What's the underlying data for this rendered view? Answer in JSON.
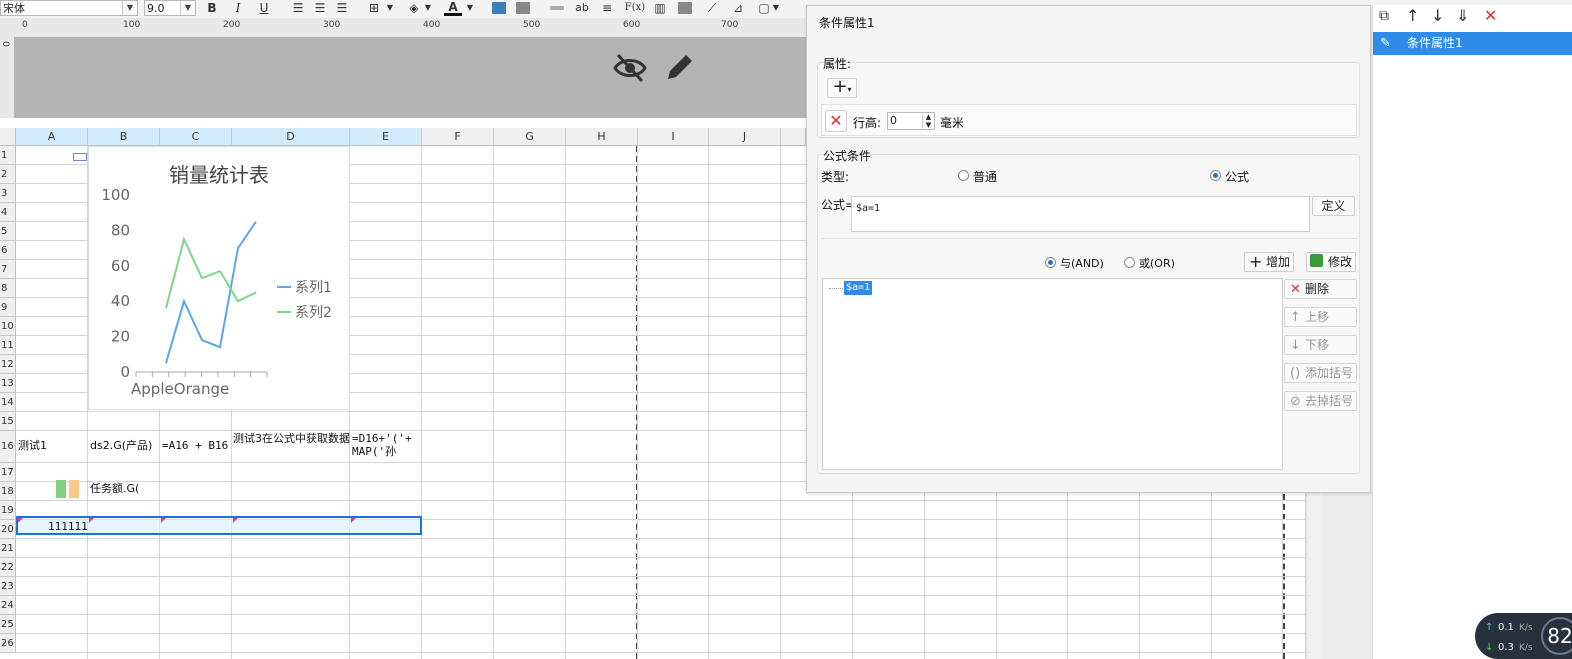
{
  "toolbar": {
    "font_name": "宋体",
    "font_size": "9.0",
    "bold": "B",
    "italic": "I",
    "underline": "U",
    "font_color_letter": "A",
    "text_icon": "ab",
    "formula_icon": "F(x)"
  },
  "ruler": {
    "ticks": [
      "0",
      "100",
      "200",
      "300",
      "400",
      "500",
      "600",
      "700"
    ]
  },
  "band_icons": [
    "eye-off-icon",
    "pencil-icon"
  ],
  "grid": {
    "columns": [
      "A",
      "B",
      "C",
      "D",
      "E",
      "F",
      "G",
      "H",
      "I",
      "J"
    ],
    "rows": [
      "1",
      "2",
      "3",
      "4",
      "5",
      "6",
      "7",
      "8",
      "9",
      "10",
      "11",
      "12",
      "13",
      "14",
      "15",
      "16",
      "17",
      "18",
      "19",
      "20",
      "21",
      "22",
      "23",
      "24",
      "25",
      "26"
    ],
    "cells": {
      "a16": "测试1",
      "b16": "ds2.G(产品)",
      "c16": "=A16 + B16",
      "d16": "测试3在公式中获取数据",
      "e16": "=D16+'('+ MAP('孙",
      "b18": "任务额.G(",
      "a20": "111111"
    }
  },
  "chart_data": {
    "type": "line",
    "title": "销量统计表",
    "x": [
      "Apple",
      "",
      "Orange",
      "",
      "",
      "",
      "",
      ""
    ],
    "tick_labels_x": [
      "Apple",
      "Orange"
    ],
    "ylim": [
      0,
      100
    ],
    "yticks": [
      "0",
      "20",
      "40",
      "60",
      "80",
      "100"
    ],
    "series": [
      {
        "name": "系列1",
        "color": "#5aa6e6",
        "values": [
          5,
          40,
          18,
          14,
          70,
          85
        ]
      },
      {
        "name": "系列2",
        "color": "#7ed58c",
        "values": [
          36,
          75,
          53,
          57,
          40,
          45
        ]
      }
    ],
    "legend": "right"
  },
  "dialog": {
    "title": "条件属性1",
    "attr_section": "属性:",
    "add_symbol": "+",
    "row_height_label": "行高:",
    "row_height_value": "0",
    "unit": "毫米",
    "formula_section": "公式条件",
    "type_label": "类型:",
    "type_normal": "普通",
    "type_formula": "公式",
    "formula_label": "公式=",
    "formula_value": "$a=1",
    "define_button": "定义",
    "and_label": "与(AND)",
    "or_label": "或(OR)",
    "add_button": "增加",
    "modify_button": "修改",
    "condition_items": [
      "$a=1"
    ],
    "delete_button": "删除",
    "up_button": "上移",
    "down_button": "下移",
    "add_bracket_button": "添加括号",
    "remove_bracket_button": "去掉括号"
  },
  "right_panel": {
    "items": [
      "条件属性1"
    ]
  },
  "network": {
    "upload": "0.1",
    "download": "0.3",
    "unit": "K/s",
    "gauge": "82"
  }
}
